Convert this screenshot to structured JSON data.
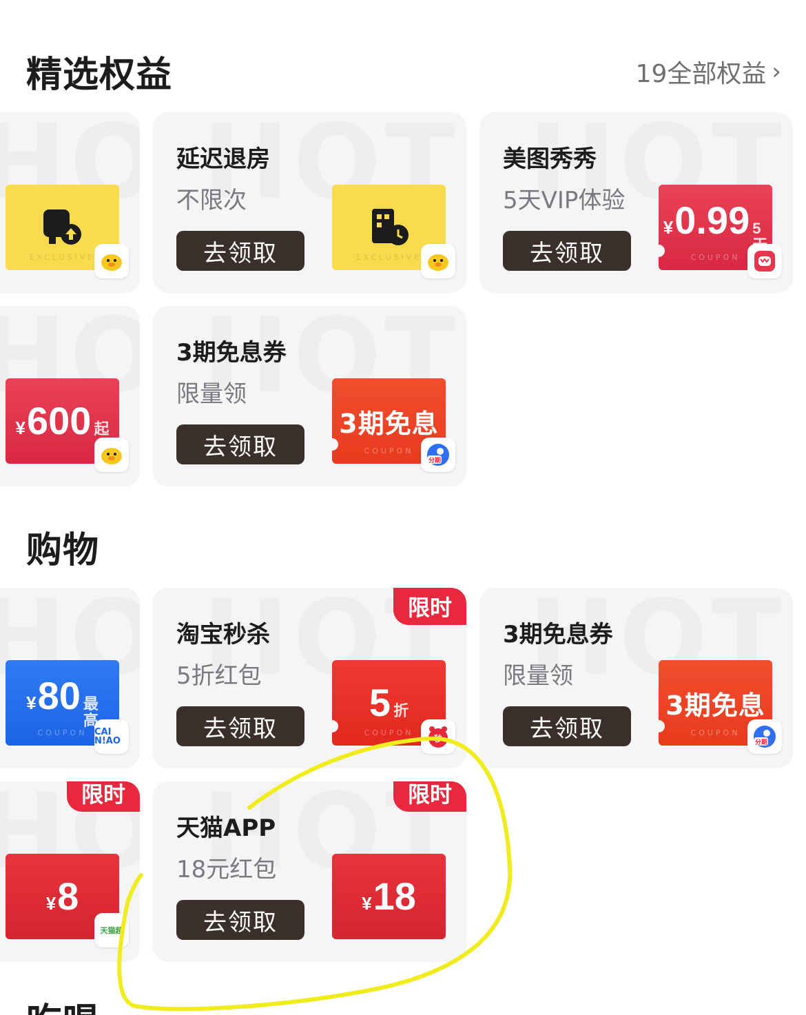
{
  "featured": {
    "title": "精选权益",
    "see_all": "19全部权益",
    "cards": [
      {
        "title": "",
        "subtitle": "",
        "cta": "",
        "coupon_text": "",
        "coupon_type": "yellow"
      },
      {
        "title": "延迟退房",
        "subtitle": "不限次",
        "cta": "去领取",
        "coupon_type": "yellow"
      },
      {
        "title": "美图秀秀",
        "subtitle": "5天VIP体验",
        "cta": "去领取",
        "coupon_type": "red",
        "yen": "¥",
        "num": "0.99",
        "suffix1": "5",
        "suffix2": "天"
      },
      {
        "title": "",
        "subtitle": "",
        "cta": "",
        "coupon_type": "red",
        "yen": "¥",
        "num": "600",
        "suffix1": "起"
      },
      {
        "title": "3期免息券",
        "subtitle": "限量领",
        "cta": "去领取",
        "coupon_type": "orange",
        "big": "3期免息"
      }
    ]
  },
  "shopping": {
    "title": "购物",
    "cards": [
      {
        "coupon_type": "blue",
        "yen": "¥",
        "num": "80",
        "suffix1": "最",
        "suffix2": "高",
        "brand": "CAI N!AO"
      },
      {
        "title": "淘宝秒杀",
        "subtitle": "5折红包",
        "cta": "去领取",
        "coupon_type": "red",
        "num": "5",
        "suffix1": "折",
        "tag": "限时"
      },
      {
        "title": "3期免息券",
        "subtitle": "限量领",
        "cta": "去领取",
        "coupon_type": "orange",
        "big": "3期免息"
      },
      {
        "coupon_type": "tmred",
        "yen": "¥",
        "num": "8",
        "tag": "限时",
        "brand": "天猫超"
      },
      {
        "title": "天猫APP",
        "subtitle": "18元红包",
        "cta": "去领取",
        "coupon_type": "tmred",
        "yen": "¥",
        "num": "18",
        "tag": "限时"
      }
    ]
  },
  "next_section": {
    "title": "吃喝"
  },
  "coupon_caption": "COUPON",
  "exclusive_caption": "EXCLUSIVE",
  "watermark": "HOT",
  "badge_fenqi": "分期",
  "badge_miao": "秒",
  "colors": {
    "accent_red": "#e8283c",
    "cta_brown": "#3a2f2b",
    "highlight": "#f0ec1e"
  }
}
